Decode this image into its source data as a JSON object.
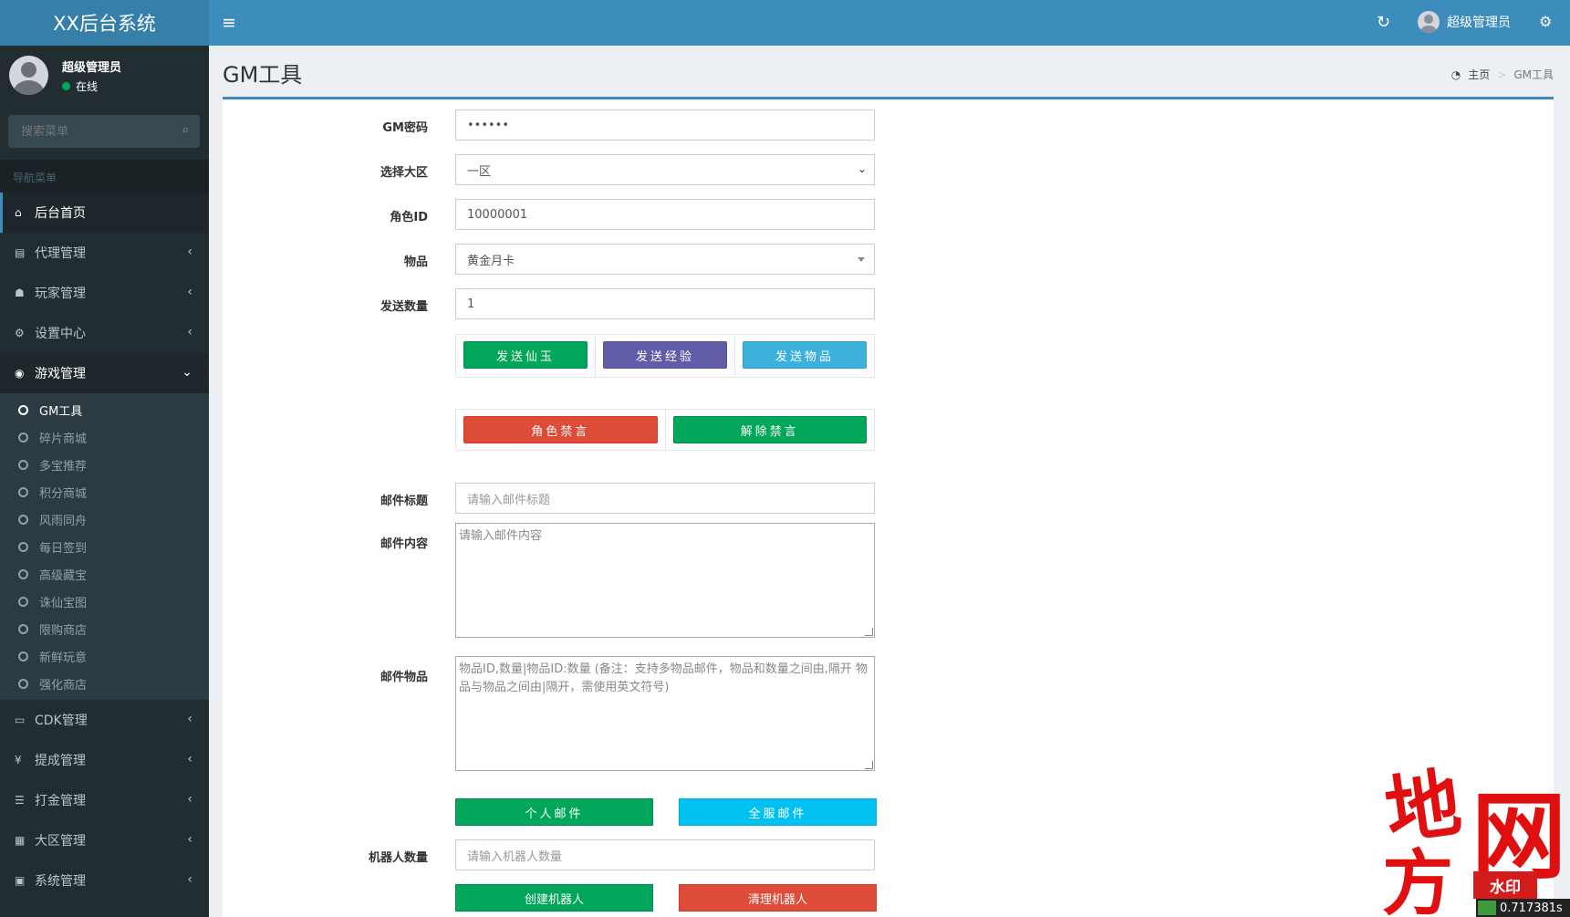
{
  "app": {
    "title": "XX后台系统"
  },
  "topbar": {
    "user_name": "超级管理员"
  },
  "user_panel": {
    "name": "超级管理员",
    "status": "在线"
  },
  "search": {
    "placeholder": "搜索菜单"
  },
  "nav": {
    "header": "导航菜单",
    "items": [
      {
        "label": "后台首页",
        "icon": "home-icon",
        "glyph": "⌂"
      },
      {
        "label": "代理管理",
        "icon": "id-card-icon",
        "glyph": "▤"
      },
      {
        "label": "玩家管理",
        "icon": "users-icon",
        "glyph": "☗"
      },
      {
        "label": "设置中心",
        "icon": "cogs-icon",
        "glyph": "⚙"
      },
      {
        "label": "游戏管理",
        "icon": "gamepad-icon",
        "glyph": "◉"
      },
      {
        "label": "CDK管理",
        "icon": "credit-card-icon",
        "glyph": "▭"
      },
      {
        "label": "提成管理",
        "icon": "yen-icon",
        "glyph": "¥"
      },
      {
        "label": "打金管理",
        "icon": "list-icon",
        "glyph": "☰"
      },
      {
        "label": "大区管理",
        "icon": "th-large-icon",
        "glyph": "▦"
      },
      {
        "label": "系统管理",
        "icon": "desktop-icon",
        "glyph": "▣"
      }
    ],
    "game_sub": [
      "GM工具",
      "碎片商城",
      "多宝推荐",
      "积分商城",
      "风雨同舟",
      "每日签到",
      "高级藏宝",
      "诛仙宝图",
      "限购商店",
      "新鲜玩意",
      "强化商店"
    ]
  },
  "page": {
    "title": "GM工具"
  },
  "breadcrumb": {
    "home": "主页",
    "current": "GM工具"
  },
  "form": {
    "gm_password": {
      "label": "GM密码",
      "value": "••••••"
    },
    "region": {
      "label": "选择大区",
      "value": "一区"
    },
    "role_id": {
      "label": "角色ID",
      "value": "10000001"
    },
    "item": {
      "label": "物品",
      "value": "黄金月卡"
    },
    "send_qty": {
      "label": "发送数量",
      "value": "1"
    },
    "btn_send_jade": "发送仙玉",
    "btn_send_exp": "发送经验",
    "btn_send_item": "发送物品",
    "btn_mute": "角色禁言",
    "btn_unmute": "解除禁言",
    "mail_title": {
      "label": "邮件标题",
      "placeholder": "请输入邮件标题"
    },
    "mail_content": {
      "label": "邮件内容",
      "placeholder": "请输入邮件内容"
    },
    "mail_items": {
      "label": "邮件物品",
      "placeholder": "物品ID,数量|物品ID:数量 (备注：支持多物品邮件，物品和数量之间由,隔开 物品与物品之间由|隔开，需使用英文符号)"
    },
    "btn_personal_mail": "个人邮件",
    "btn_server_mail": "全服邮件",
    "robot_count": {
      "label": "机器人数量",
      "placeholder": "请输入机器人数量"
    },
    "btn_create_robot": "创建机器人",
    "btn_clear_robot": "清理机器人"
  },
  "watermark": {
    "chars": [
      "地",
      "方",
      "网"
    ],
    "tag": "水印"
  },
  "timer": "0.717381s",
  "colors": {
    "header": "#3c8dbc",
    "logo": "#367fa9",
    "sidebar": "#222d32",
    "green": "#00a65a",
    "purple": "#605ca8",
    "blue": "#3db0dc",
    "red": "#dd4b39",
    "aqua": "#00c0ef"
  }
}
